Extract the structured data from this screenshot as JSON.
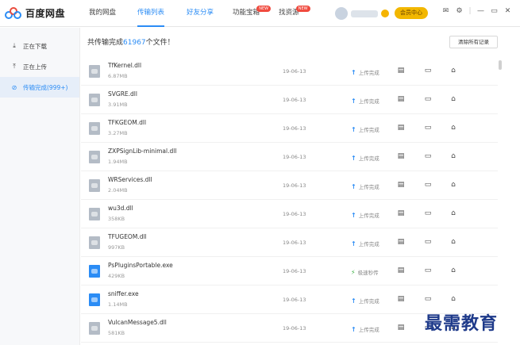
{
  "app": {
    "name": "百度网盘"
  },
  "nav": {
    "items": [
      {
        "label": "我的网盘"
      },
      {
        "label": "传输列表"
      },
      {
        "label": "好友分享"
      },
      {
        "label": "功能宝箱",
        "badge": "NEW"
      },
      {
        "label": "找资源",
        "badge": "NEW"
      }
    ]
  },
  "vip": {
    "label": "会员中心"
  },
  "sidebar": {
    "items": [
      {
        "label": "正在下载",
        "icon": "download-icon"
      },
      {
        "label": "正在上传",
        "icon": "upload-icon"
      },
      {
        "label": "传输完成(999+)",
        "icon": "check-circle-icon"
      }
    ]
  },
  "summary": {
    "prefix": "共传输完成",
    "count": "61967",
    "suffix": "个文件！"
  },
  "clear_button": {
    "label": "清除所有记录"
  },
  "files": [
    {
      "name": "TfKernel.dll",
      "size": "6.87MB",
      "date": "19-06-13",
      "status": "上传完成",
      "type": "dll"
    },
    {
      "name": "SVGRE.dll",
      "size": "3.91MB",
      "date": "19-06-13",
      "status": "上传完成",
      "type": "dll"
    },
    {
      "name": "TFKGEOM.dll",
      "size": "3.27MB",
      "date": "19-06-13",
      "status": "上传完成",
      "type": "dll"
    },
    {
      "name": "ZXPSignLib-minimal.dll",
      "size": "1.94MB",
      "date": "19-06-13",
      "status": "上传完成",
      "type": "dll"
    },
    {
      "name": "WRServices.dll",
      "size": "2.04MB",
      "date": "19-06-13",
      "status": "上传完成",
      "type": "dll"
    },
    {
      "name": "wu3d.dll",
      "size": "358KB",
      "date": "19-06-13",
      "status": "上传完成",
      "type": "dll"
    },
    {
      "name": "TFUGEOM.dll",
      "size": "997KB",
      "date": "19-06-13",
      "status": "上传完成",
      "type": "dll"
    },
    {
      "name": "PsPluginsPortable.exe",
      "size": "429KB",
      "date": "19-06-13",
      "status": "极速秒传",
      "type": "exe"
    },
    {
      "name": "sniffer.exe",
      "size": "1.14MB",
      "date": "19-06-13",
      "status": "上传完成",
      "type": "exe"
    },
    {
      "name": "VulcanMessage5.dll",
      "size": "581KB",
      "date": "19-06-13",
      "status": "上传完成",
      "type": "dll"
    }
  ],
  "watermark": {
    "text": "最需教育"
  },
  "colors": {
    "accent": "#2b8cf5",
    "badge": "#f04a3e",
    "vip": "#f2b700",
    "instant": "#3cb043"
  }
}
